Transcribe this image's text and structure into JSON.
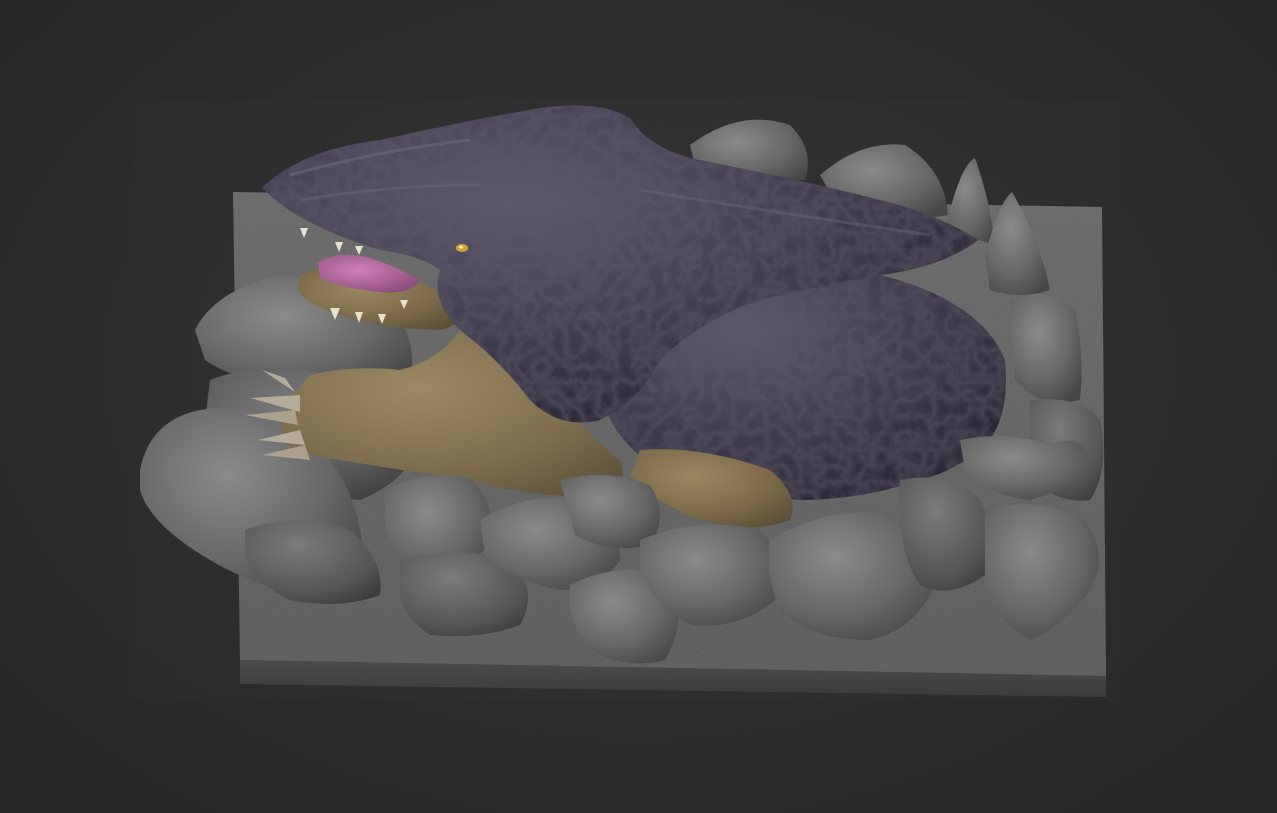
{
  "viewport": {
    "background_color": "#2c2c2c"
  },
  "model": {
    "base_color": "#5c5c5c",
    "rock_color": "#6a6a6a",
    "creature_skin_color": "#3c3846",
    "limb_color": "#7d6a4a",
    "tongue_color": "#b0609a",
    "eye_color": "#d8a030"
  }
}
